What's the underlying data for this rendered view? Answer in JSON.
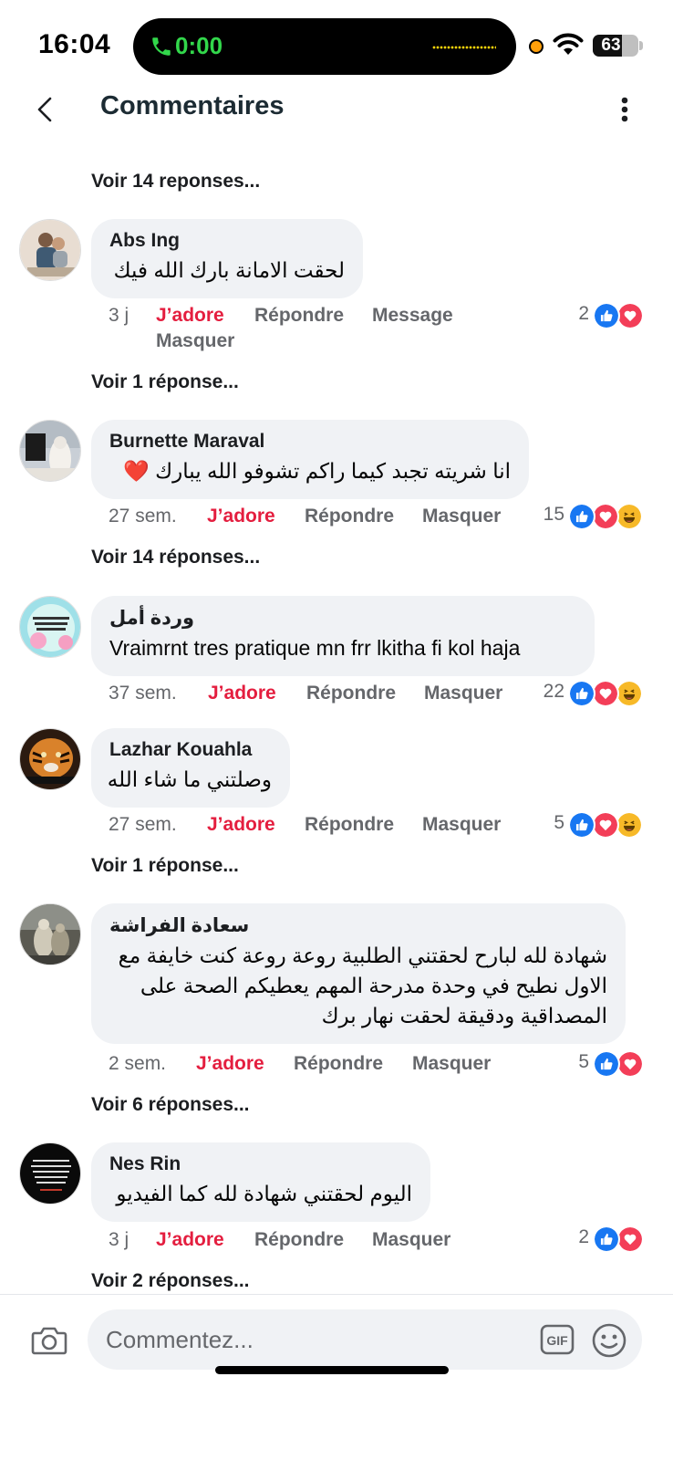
{
  "status_bar": {
    "time": "16:04",
    "call_time": "0:00",
    "battery": "63",
    "battery_level": 0.63
  },
  "header": {
    "title": "Commentaires"
  },
  "top_more_replies": "Voir 14 reponses...",
  "comments": [
    {
      "author": "Abs Ing",
      "text": "لحقت الامانة بارك الله فيك",
      "time": "3 j",
      "love": "J’adore",
      "reply": "Répondre",
      "message": "Message",
      "hide": "Masquer",
      "reaction_count": "2",
      "reactions": [
        "like-icon",
        "love-icon"
      ],
      "more_replies": "Voir 1 réponse..."
    },
    {
      "author": "Burnette Maraval",
      "text": "انا شريته تجبد كيما راكم تشوفو الله يبارك ❤️",
      "time": "27 sem.",
      "love": "J’adore",
      "reply": "Répondre",
      "hide": "Masquer",
      "reaction_count": "15",
      "reactions": [
        "like-icon",
        "love-icon",
        "haha-icon"
      ],
      "more_replies": "Voir 14 réponses..."
    },
    {
      "author": "وردة أمل",
      "text": "Vraimrnt tres pratique mn frr lkitha fi kol haja",
      "time": "37 sem.",
      "love": "J’adore",
      "reply": "Répondre",
      "hide": "Masquer",
      "reaction_count": "22",
      "reactions": [
        "like-icon",
        "love-icon",
        "haha-icon"
      ]
    },
    {
      "author": "Lazhar Kouahla",
      "text": "وصلتني ما شاء الله",
      "time": "27 sem.",
      "love": "J’adore",
      "reply": "Répondre",
      "hide": "Masquer",
      "reaction_count": "5",
      "reactions": [
        "like-icon",
        "love-icon",
        "haha-icon"
      ],
      "more_replies": "Voir 1 réponse..."
    },
    {
      "author": "سعادة الفراشة",
      "text": "شهادة لله لبارح لحقتني الطلبية روعة روعة كنت خايفة مع الاول نطيح في وحدة مدرحة المهم يعطيكم الصحة على المصداقية ودقيقة لحقت نهار برك",
      "time": "2 sem.",
      "love": "J’adore",
      "reply": "Répondre",
      "hide": "Masquer",
      "reaction_count": "5",
      "reactions": [
        "like-icon",
        "love-icon"
      ],
      "more_replies": "Voir 6 réponses..."
    },
    {
      "author": "Nes Rin",
      "text": "اليوم لحقتني شهادة لله كما الفيديو",
      "time": "3 j",
      "love": "J’adore",
      "reply": "Répondre",
      "hide": "Masquer",
      "reaction_count": "2",
      "reactions": [
        "like-icon",
        "love-icon"
      ],
      "more_replies": "Voir 2 réponses..."
    }
  ],
  "composer": {
    "placeholder": "Commentez...",
    "camera": "camera-icon",
    "gif": "GIF",
    "emoji": "emoji-icon"
  },
  "colors": {
    "love": "#e41e3f",
    "like": "#1877f2",
    "bubble": "#f0f2f5",
    "muted": "#65676b"
  }
}
